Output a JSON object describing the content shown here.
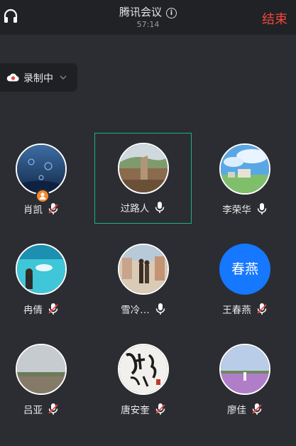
{
  "header": {
    "title": "腾讯会议",
    "timer": "57:14",
    "end_label": "结束",
    "info_icon": "i"
  },
  "recording": {
    "label": "录制中"
  },
  "participants": [
    {
      "name": "肖凯",
      "mic": "muted",
      "host": true
    },
    {
      "name": "过路人",
      "mic": "on",
      "active": true
    },
    {
      "name": "李荣华",
      "mic": "on"
    },
    {
      "name": "冉倩",
      "mic": "muted"
    },
    {
      "name": "雪冷…",
      "mic": "on"
    },
    {
      "name": "王春燕",
      "mic": "muted",
      "initials": "春燕"
    },
    {
      "name": "吕亚",
      "mic": "muted"
    },
    {
      "name": "唐安奎",
      "mic": "muted"
    },
    {
      "name": "廖佳",
      "mic": "muted"
    }
  ],
  "colors": {
    "end": "#f0453f",
    "active_border": "#1eb27a",
    "initials_bg": "#1677ff",
    "host_badge": "#f28a2d",
    "mute_slash": "#f0453f"
  }
}
